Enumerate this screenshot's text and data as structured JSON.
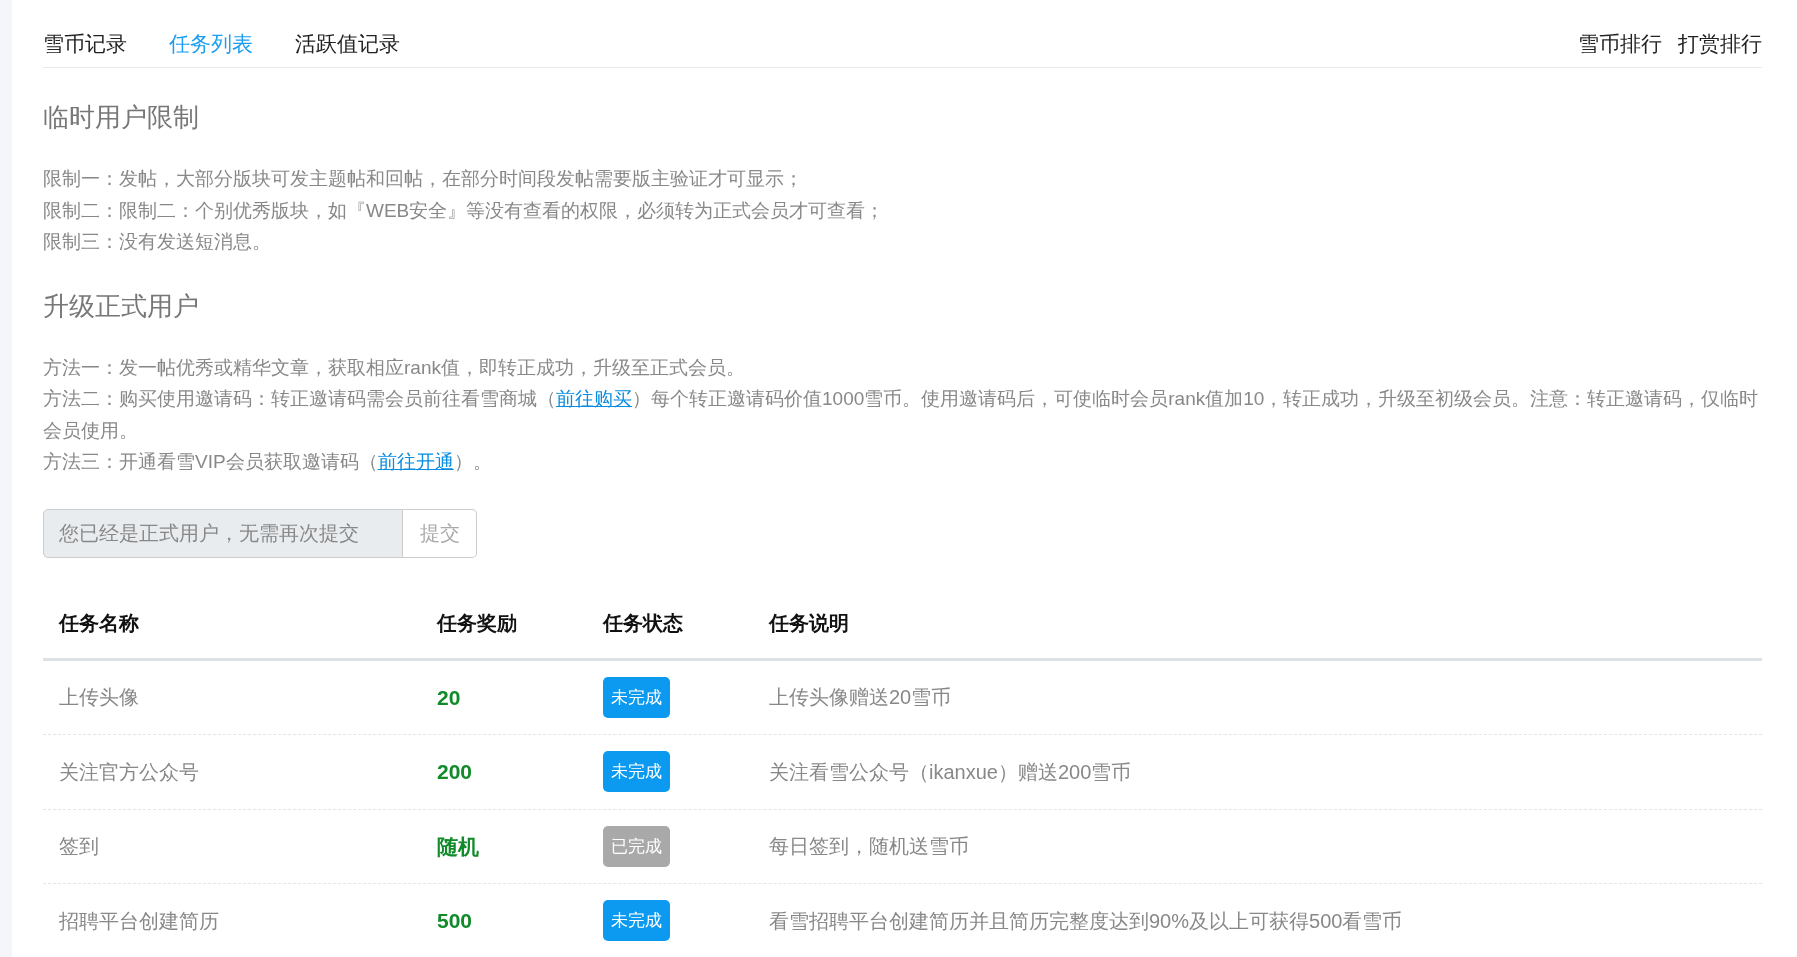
{
  "tabs": [
    {
      "label": "雪币记录",
      "selected": false
    },
    {
      "label": "任务列表",
      "selected": true
    },
    {
      "label": "活跃值记录",
      "selected": false
    }
  ],
  "right_links": [
    "雪币排行",
    "打赏排行"
  ],
  "sections": [
    {
      "heading": "临时用户限制",
      "paragraphs": [
        {
          "parts": [
            {
              "text": "限制一：发帖，大部分版块可发主题帖和回帖，在部分时间段发帖需要版主验证才可显示；"
            }
          ]
        },
        {
          "parts": [
            {
              "text": "限制二：限制二：个别优秀版块，如『WEB安全』等没有查看的权限，必须转为正式会员才可查看；"
            }
          ]
        },
        {
          "parts": [
            {
              "text": "限制三：没有发送短消息。"
            }
          ]
        }
      ]
    },
    {
      "heading": "升级正式用户",
      "paragraphs": [
        {
          "parts": [
            {
              "text": "方法一：发一帖优秀或精华文章，获取相应rank值，即转正成功，升级至正式会员。"
            }
          ]
        },
        {
          "parts": [
            {
              "text": "方法二：购买使用邀请码：转正邀请码需会员前往看雪商城（"
            },
            {
              "text": "前往购买",
              "link": true
            },
            {
              "text": "）每个转正邀请码价值1000雪币。使用邀请码后，可使临时会员rank值加10，转正成功，升级至初级会员。注意：转正邀请码，仅临时会员使用。"
            }
          ]
        },
        {
          "parts": [
            {
              "text": "方法三：开通看雪VIP会员获取邀请码（"
            },
            {
              "text": "前往开通",
              "link": true
            },
            {
              "text": "）。"
            }
          ]
        }
      ]
    }
  ],
  "submit": {
    "placeholder": "您已经是正式用户，无需再次提交",
    "disabled": true,
    "button": "提交"
  },
  "table": {
    "columns": [
      "任务名称",
      "任务奖励",
      "任务状态",
      "任务说明"
    ],
    "rows": [
      {
        "name": "上传头像",
        "reward": "20",
        "status": "未完成",
        "completed": false,
        "description": "上传头像赠送20雪币"
      },
      {
        "name": "关注官方公众号",
        "reward": "200",
        "status": "未完成",
        "completed": false,
        "description": "关注看雪公众号（ikanxue）赠送200雪币"
      },
      {
        "name": "签到",
        "reward": "随机",
        "status": "已完成",
        "completed": true,
        "description": "每日签到，随机送雪币"
      },
      {
        "name": "招聘平台创建简历",
        "reward": "500",
        "status": "未完成",
        "completed": false,
        "description": "看雪招聘平台创建简历并且简历完整度达到90%及以上可获得500看雪币"
      }
    ]
  }
}
